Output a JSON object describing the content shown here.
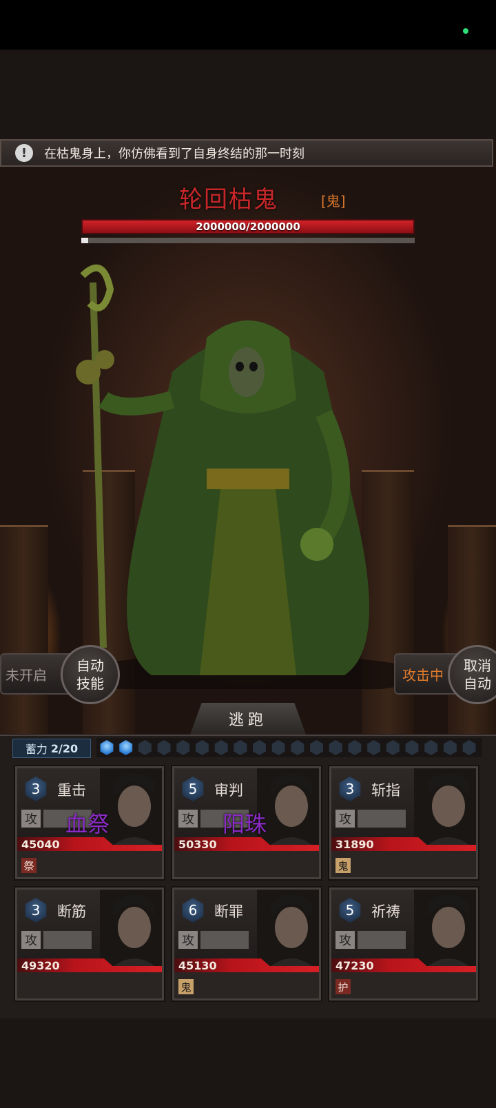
{
  "notice": {
    "text": "在枯鬼身上，你仿佛看到了自身终结的那一时刻",
    "icon": "exclamation-icon"
  },
  "boss": {
    "name": "轮回枯鬼",
    "tag": "[鬼]",
    "hp_text": "2000000/2000000",
    "hp_fraction": 1.0
  },
  "controls": {
    "left_status": "未开启",
    "auto_skill": "自动\n技能",
    "right_status": "攻击中",
    "cancel_auto": "取消\n自动",
    "flee": "逃跑"
  },
  "charge": {
    "label_prefix": "蓄力",
    "value": "2/20",
    "filled": 2,
    "total": 20
  },
  "cards": [
    {
      "level": "3",
      "skill": "重击",
      "atk": "攻",
      "overlay": "血祭",
      "hp": "45040",
      "tag": "祭",
      "tag_color": "#7a2a22"
    },
    {
      "level": "5",
      "skill": "审判",
      "atk": "攻",
      "overlay": "阳珠",
      "hp": "50330",
      "tag": "",
      "tag_color": ""
    },
    {
      "level": "3",
      "skill": "斩指",
      "atk": "攻",
      "overlay": "",
      "hp": "31890",
      "tag": "鬼",
      "tag_color": "#c8a06a"
    },
    {
      "level": "3",
      "skill": "断筋",
      "atk": "攻",
      "overlay": "",
      "hp": "49320",
      "tag": "",
      "tag_color": ""
    },
    {
      "level": "6",
      "skill": "断罪",
      "atk": "攻",
      "overlay": "",
      "hp": "45130",
      "tag": "鬼",
      "tag_color": "#c8a06a"
    },
    {
      "level": "5",
      "skill": "祈祷",
      "atk": "攻",
      "overlay": "",
      "hp": "47230",
      "tag": "护",
      "tag_color": "#7a2a22"
    }
  ]
}
